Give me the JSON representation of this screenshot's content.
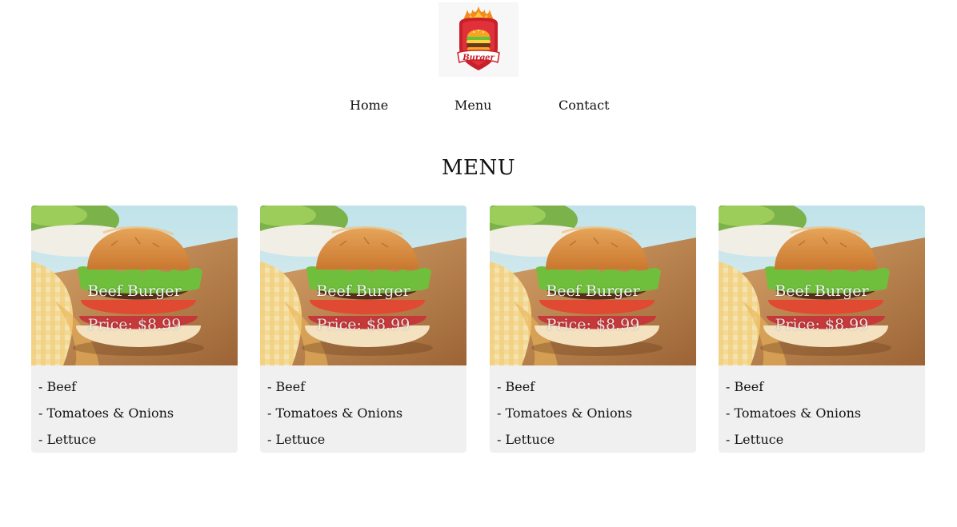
{
  "header": {
    "logo_text": "Burger"
  },
  "nav": {
    "items": [
      {
        "label": "Home"
      },
      {
        "label": "Menu"
      },
      {
        "label": "Contact"
      }
    ]
  },
  "main": {
    "title": "MENU",
    "cards": [
      {
        "name": "Beef Burger",
        "price": "Price: $8.99",
        "ingredients": [
          "- Beef",
          "- Tomatoes & Onions",
          "- Lettuce"
        ]
      },
      {
        "name": "Beef Burger",
        "price": "Price: $8.99",
        "ingredients": [
          "- Beef",
          "- Tomatoes & Onions",
          "- Lettuce"
        ]
      },
      {
        "name": "Beef Burger",
        "price": "Price: $8.99",
        "ingredients": [
          "- Beef",
          "- Tomatoes & Onions",
          "- Lettuce"
        ]
      },
      {
        "name": "Beef Burger",
        "price": "Price: $8.99",
        "ingredients": [
          "- Beef",
          "- Tomatoes & Onions",
          "- Lettuce"
        ]
      }
    ]
  },
  "colors": {
    "card_background": "#f0f0f0",
    "logo_red": "#c8202a",
    "logo_orange": "#f28c1e",
    "text": "#111111"
  },
  "icons": {
    "logo": "burger-logo-icon",
    "card_image": "burger-photo-icon"
  }
}
